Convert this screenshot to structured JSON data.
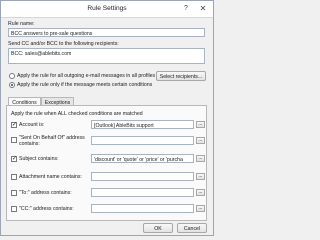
{
  "window": {
    "title": "Rule Settings",
    "help_glyph": "?",
    "close_glyph": "✕"
  },
  "rule_name": {
    "label": "Rule name:",
    "value": "BCC answers to pre-sale questions"
  },
  "send_cc": {
    "label": "Send CC and/or BCC to the following recipients:",
    "value": "BCC: sales@ablebits.com"
  },
  "scope": {
    "option_all": "Apply the rule for all outgoing e-mail messages in all profiles",
    "option_conditions": "Apply the rule only if the message meets certain conditions",
    "selected": "conditions",
    "select_recipients": "Select recipients..."
  },
  "tabs": {
    "conditions": "Conditions",
    "exceptions": "Exceptions",
    "active": "conditions"
  },
  "conditions": {
    "header": "Apply the rule when ALL checked conditions are matched",
    "rows": [
      {
        "label": "Account is:",
        "checked": true,
        "value": "[Outlook] AbleBits support"
      },
      {
        "label": "\"Sent On Behalf Of\" address contains:",
        "checked": false,
        "value": ""
      },
      {
        "label": "Subject contains:",
        "checked": true,
        "value": "'discount' or 'quote' or 'price' or 'purcha"
      },
      {
        "label": "Attachment name contains:",
        "checked": false,
        "value": ""
      },
      {
        "label": "\"To:\" address contains:",
        "checked": false,
        "value": ""
      },
      {
        "label": "\"CC:\" address contains:",
        "checked": false,
        "value": ""
      }
    ],
    "ellipsis": "..."
  },
  "footer": {
    "ok": "OK",
    "cancel": "Cancel"
  }
}
